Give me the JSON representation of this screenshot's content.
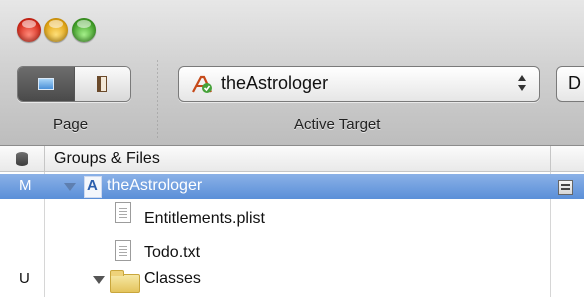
{
  "toolbar": {
    "page_label": "Page",
    "active_target_label": "Active Target",
    "active_target_value": "theAstrologer",
    "next_button_text": "D"
  },
  "outline": {
    "header_title": "Groups & Files",
    "rows": [
      {
        "scm": "M",
        "label": "theAstrologer",
        "selected": true,
        "icon": "project-icon"
      },
      {
        "scm": "",
        "label": "Entitlements.plist",
        "icon": "plist-file-icon"
      },
      {
        "scm": "",
        "label": "Todo.txt",
        "icon": "text-file-icon"
      },
      {
        "scm": "U",
        "label": "Classes",
        "icon": "folder-icon"
      }
    ]
  },
  "colors": {
    "selection": "#5a8fd8",
    "toolbar_top": "#e7e7e7",
    "toolbar_bottom": "#bdbdbd"
  }
}
